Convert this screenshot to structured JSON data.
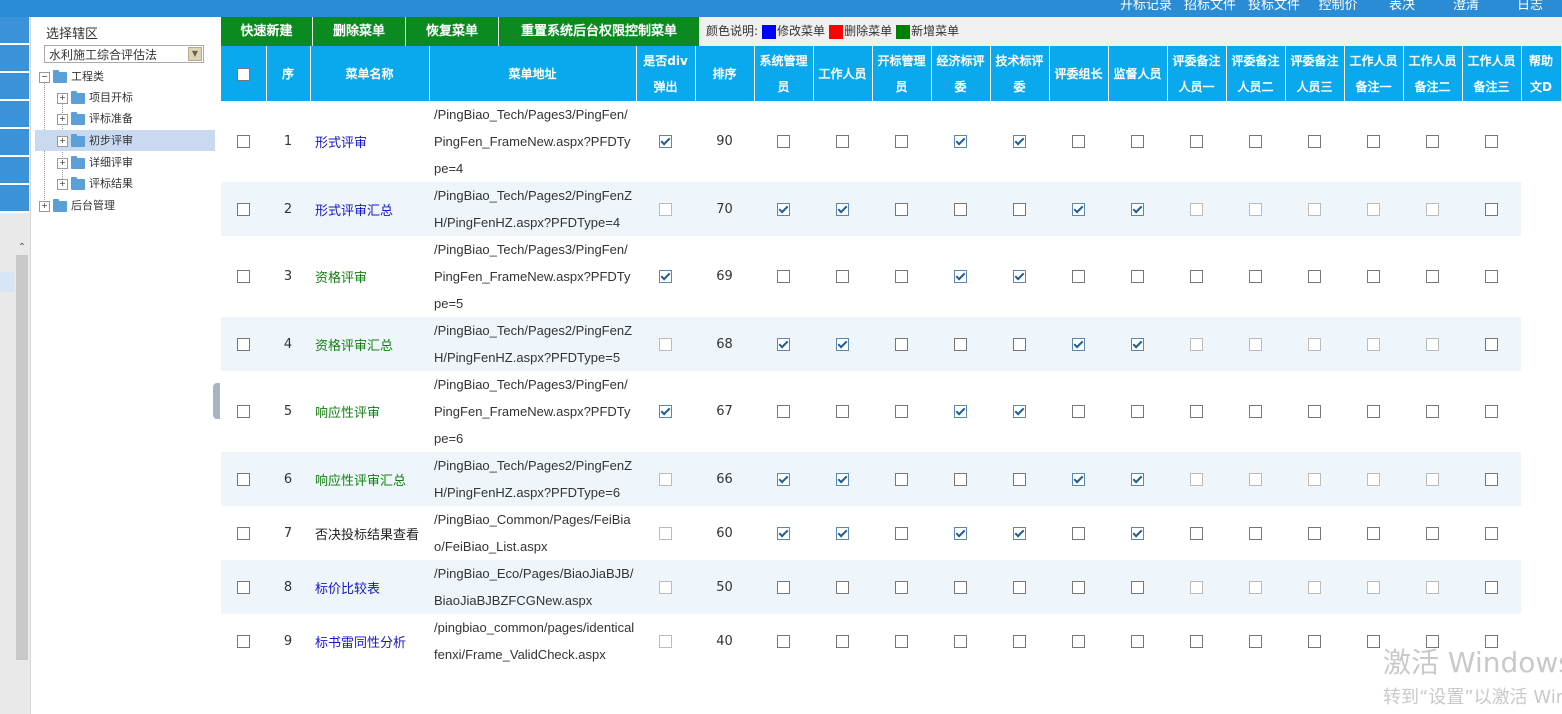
{
  "top_nav": [
    "开标记录",
    "招标文件",
    "投标文件",
    "控制价",
    "表决",
    "澄清",
    "日志"
  ],
  "tree": {
    "region_label": "选择辖区",
    "region_value": "水利施工综合评估法",
    "nodes": [
      {
        "label": "工程类",
        "toggle": "−"
      },
      {
        "label": "项目开标",
        "toggle": "+"
      },
      {
        "label": "评标准备",
        "toggle": "+"
      },
      {
        "label": "初步评审",
        "toggle": "+",
        "selected": true
      },
      {
        "label": "详细评审",
        "toggle": "+"
      },
      {
        "label": "评标结果",
        "toggle": "+"
      },
      {
        "label": "后台管理",
        "toggle": "+"
      }
    ]
  },
  "toolbar": {
    "buttons": [
      "快速新建",
      "删除菜单",
      "恢复菜单",
      "重置系统后台权限控制菜单"
    ],
    "legend_label": "颜色说明:",
    "legend_items": [
      {
        "label": "修改菜单",
        "color": "#0000ff"
      },
      {
        "label": "删除菜单",
        "color": "#ff0000"
      },
      {
        "label": "新增菜单",
        "color": "#008000"
      }
    ]
  },
  "columns": [
    "",
    "序",
    "菜单名称",
    "菜单地址",
    "是否div弹出",
    "排序",
    "系统管理员",
    "工作人员",
    "开标管理员",
    "经济标评委",
    "技术标评委",
    "评委组长",
    "监督人员",
    "评委备注人员一",
    "评委备注人员二",
    "评委备注人员三",
    "工作人员备注一",
    "工作人员备注二",
    "工作人员备注三",
    "帮助文D"
  ],
  "rows": [
    {
      "no": "1",
      "name": "形式评审",
      "color": "blue",
      "url": "/PingBiao_Tech/Pages3/PingFen/PingFen_FrameNew.aspx?PFDType=4",
      "div": true,
      "sort": "90",
      "roles": [
        0,
        0,
        0,
        1,
        1,
        0,
        0,
        0,
        0,
        0,
        0,
        0,
        0
      ]
    },
    {
      "no": "2",
      "name": "形式评审汇总",
      "color": "blue",
      "url": "/PingBiao_Tech/Pages2/PingFenZH/PingFenHZ.aspx?PFDType=4",
      "div": false,
      "sort": "70",
      "roles": [
        1,
        1,
        0,
        0,
        0,
        1,
        1,
        0,
        0,
        0,
        0,
        0,
        0
      ]
    },
    {
      "no": "3",
      "name": "资格评审",
      "color": "green",
      "url": "/PingBiao_Tech/Pages3/PingFen/PingFen_FrameNew.aspx?PFDType=5",
      "div": true,
      "sort": "69",
      "roles": [
        0,
        0,
        0,
        1,
        1,
        0,
        0,
        0,
        0,
        0,
        0,
        0,
        0
      ]
    },
    {
      "no": "4",
      "name": "资格评审汇总",
      "color": "green",
      "url": "/PingBiao_Tech/Pages2/PingFenZH/PingFenHZ.aspx?PFDType=5",
      "div": false,
      "sort": "68",
      "roles": [
        1,
        1,
        0,
        0,
        0,
        1,
        1,
        0,
        0,
        0,
        0,
        0,
        0
      ]
    },
    {
      "no": "5",
      "name": "响应性评审",
      "color": "green",
      "url": "/PingBiao_Tech/Pages3/PingFen/PingFen_FrameNew.aspx?PFDType=6",
      "div": true,
      "sort": "67",
      "roles": [
        0,
        0,
        0,
        1,
        1,
        0,
        0,
        0,
        0,
        0,
        0,
        0,
        0
      ]
    },
    {
      "no": "6",
      "name": "响应性评审汇总",
      "color": "green",
      "url": "/PingBiao_Tech/Pages2/PingFenZH/PingFenHZ.aspx?PFDType=6",
      "div": false,
      "sort": "66",
      "roles": [
        1,
        1,
        0,
        0,
        0,
        1,
        1,
        0,
        0,
        0,
        0,
        0,
        0
      ]
    },
    {
      "no": "7",
      "name": "否决投标结果查看",
      "color": "black",
      "url": "/PingBiao_Common/Pages/FeiBiao/FeiBiao_List.aspx",
      "div": false,
      "sort": "60",
      "roles": [
        1,
        1,
        0,
        1,
        1,
        0,
        1,
        0,
        0,
        0,
        0,
        0,
        0
      ]
    },
    {
      "no": "8",
      "name": "标价比较表",
      "color": "blue",
      "url": "/PingBiao_Eco/Pages/BiaoJiaBJB/BiaoJiaBJBZFCGNew.aspx",
      "div": false,
      "sort": "50",
      "roles": [
        0,
        0,
        0,
        0,
        0,
        0,
        0,
        0,
        0,
        0,
        0,
        0,
        0
      ]
    },
    {
      "no": "9",
      "name": "标书雷同性分析",
      "color": "blue",
      "url": "/pingbiao_common/pages/identicalfenxi/Frame_ValidCheck.aspx",
      "div": false,
      "sort": "40",
      "roles": [
        0,
        0,
        0,
        0,
        0,
        0,
        0,
        0,
        0,
        0,
        0,
        0,
        0
      ]
    }
  ],
  "watermark": {
    "line1": "激活 Windows",
    "line2": "转到“设置”以激活 Windows。"
  }
}
